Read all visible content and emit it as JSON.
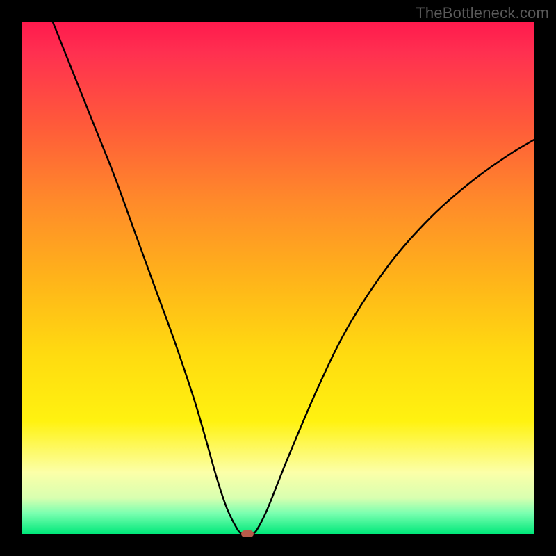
{
  "watermark": "TheBottleneck.com",
  "chart_data": {
    "type": "line",
    "title": "",
    "xlabel": "",
    "ylabel": "",
    "xlim": [
      0,
      100
    ],
    "ylim": [
      0,
      100
    ],
    "grid": false,
    "legend": false,
    "background": {
      "type": "vertical-gradient",
      "stops": [
        {
          "pos": 0,
          "color": "#ff1a4d"
        },
        {
          "pos": 50,
          "color": "#ffb31a"
        },
        {
          "pos": 78,
          "color": "#fff210"
        },
        {
          "pos": 100,
          "color": "#00e87a"
        }
      ]
    },
    "series": [
      {
        "name": "bottleneck-curve",
        "color": "#000000",
        "x": [
          6,
          10,
          14,
          18,
          22,
          26,
          30,
          34,
          38,
          40,
          42,
          43,
          44,
          45,
          46,
          48,
          52,
          58,
          64,
          72,
          80,
          88,
          95,
          100
        ],
        "y": [
          100,
          90,
          80,
          70,
          59,
          48,
          37,
          25,
          11,
          5,
          1,
          0,
          0,
          0,
          1,
          5,
          15,
          29,
          41,
          53,
          62,
          69,
          74,
          77
        ]
      }
    ],
    "marker": {
      "x": 44,
      "y": 0,
      "color": "#b85a4a"
    }
  }
}
